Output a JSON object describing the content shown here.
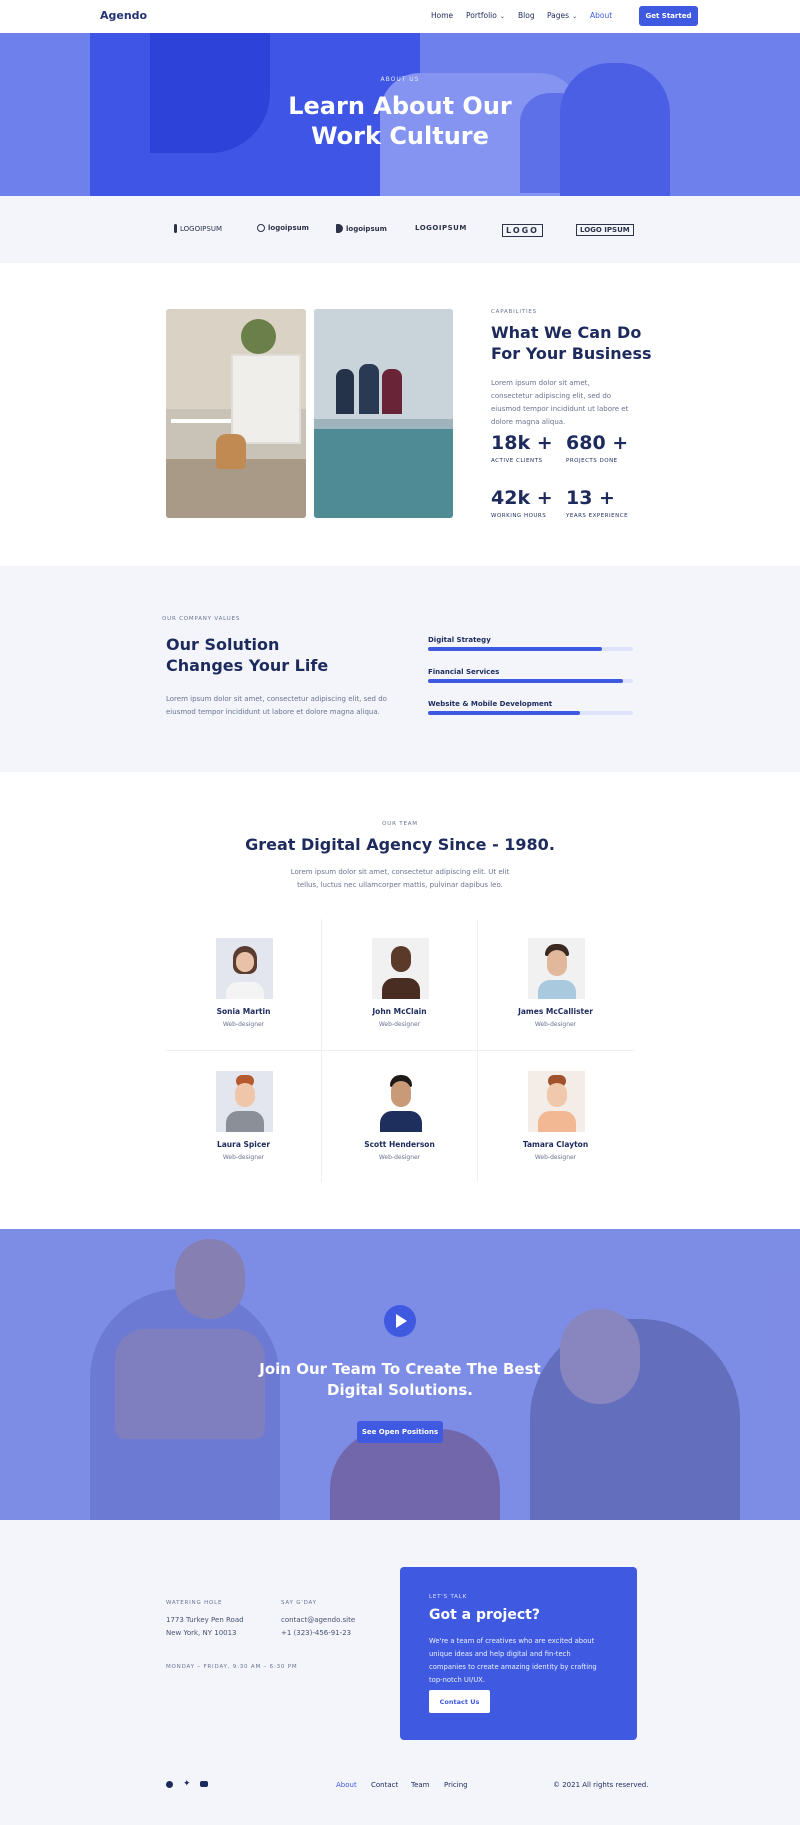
{
  "nav": {
    "logo": "Agendo",
    "items": [
      {
        "label": "Home"
      },
      {
        "label": "Portfolio"
      },
      {
        "label": "Blog"
      },
      {
        "label": "Pages"
      },
      {
        "label": "About"
      }
    ],
    "cta": "Get Started"
  },
  "hero": {
    "eyebrow": "ABOUT US",
    "title_line1": "Learn About Our",
    "title_line2": "Work Culture"
  },
  "logos": [
    "LOGOIPSUM",
    "logoipsum",
    "logoipsum",
    "LOGOIPSUM",
    "LOGO",
    "LOGO IPSUM"
  ],
  "capabilities": {
    "eyebrow": "CAPABILITIES",
    "title_line1": "What We Can Do",
    "title_line2": "For Your Business",
    "text": "Lorem ipsum dolor sit amet, consectetur adipiscing elit, sed do eiusmod tempor incididunt ut labore et dolore magna aliqua.",
    "stats": [
      {
        "value": "18k +",
        "label": "ACTIVE CLIENTS"
      },
      {
        "value": "680 +",
        "label": "PROJECTS DONE"
      },
      {
        "value": "42k +",
        "label": "WORKING HOURS"
      },
      {
        "value": "13 +",
        "label": "YEARS EXPERIENCE"
      }
    ]
  },
  "solution": {
    "eyebrow": "OUR COMPANY VALUES",
    "title_line1": "Our Solution",
    "title_line2": "Changes Your Life",
    "text": "Lorem ipsum dolor sit amet, consectetur adipiscing elit, sed do eiusmod tempor incididunt ut labore et dolore magna aliqua.",
    "skills": [
      {
        "label": "Digital Strategy",
        "value": 0.85
      },
      {
        "label": "Financial Services",
        "value": 0.95
      },
      {
        "label": "Website & Mobile Development",
        "value": 0.74
      }
    ]
  },
  "team": {
    "eyebrow": "OUR TEAM",
    "title": "Great Digital Agency Since - 1980.",
    "text": "Lorem ipsum dolor sit amet, consectetur adipiscing elit. Ut elit tellus, luctus nec ullamcorper mattis, pulvinar dapibus leo.",
    "members": [
      {
        "name": "Sonia Martin",
        "role": "Web-designer"
      },
      {
        "name": "John McClain",
        "role": "Web-designer"
      },
      {
        "name": "James McCallister",
        "role": "Web-designer"
      },
      {
        "name": "Laura Spicer",
        "role": "Web-designer"
      },
      {
        "name": "Scott Henderson",
        "role": "Web-designer"
      },
      {
        "name": "Tamara Clayton",
        "role": "Web-designer"
      }
    ]
  },
  "join": {
    "title_line1": "Join Our Team To Create The Best",
    "title_line2": "Digital Solutions.",
    "button": "See Open Positions"
  },
  "contact": {
    "address_label": "WATERING HOLE",
    "address_line1": "1773 Turkey Pen Road",
    "address_line2": "New York, NY 10013",
    "say_label": "SAY G'DAY",
    "email": "contact@agendo.site",
    "phone": "+1 (323)-456-91-23",
    "hours": "MONDAY – FRIDAY, 9:30 AM – 6:30 PM",
    "card": {
      "eyebrow": "LET'S TALK",
      "title": "Got a project?",
      "text": "We're a team of creatives who are excited about unique ideas and help digital and fin-tech companies to create amazing identity by crafting top-notch UI/UX.",
      "button": "Contact Us"
    }
  },
  "footer": {
    "links": [
      "About",
      "Contact",
      "Team",
      "Pricing"
    ],
    "copyright": "© 2021 All rights reserved."
  }
}
